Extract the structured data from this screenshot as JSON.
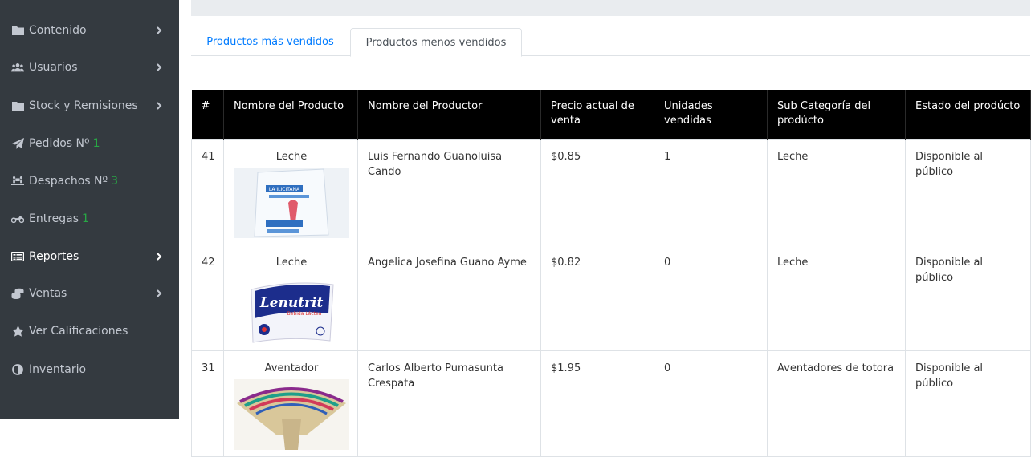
{
  "sidebar": {
    "items": [
      {
        "label": "Contenido",
        "icon": "folder-icon",
        "count": "",
        "has_chevron": true
      },
      {
        "label": "Usuarios",
        "icon": "users-icon",
        "count": "",
        "has_chevron": true
      },
      {
        "label": "Stock y Remisiones",
        "icon": "folder-icon",
        "count": "",
        "has_chevron": true
      },
      {
        "label": "Pedidos Nº",
        "icon": "paper-plane-icon",
        "count": "1",
        "has_chevron": false
      },
      {
        "label": "Despachos Nº",
        "icon": "people-carry-icon",
        "count": "3",
        "has_chevron": false
      },
      {
        "label": "Entregas",
        "icon": "motorcycle-icon",
        "count": "1",
        "has_chevron": false
      },
      {
        "label": "Reportes",
        "icon": "report-icon",
        "count": "",
        "has_chevron": true
      },
      {
        "label": "Ventas",
        "icon": "coins-icon",
        "count": "",
        "has_chevron": true
      },
      {
        "label": "Ver Calificaciones",
        "icon": "star-icon",
        "count": "",
        "has_chevron": false
      },
      {
        "label": "Inventario",
        "icon": "adjust-icon",
        "count": "",
        "has_chevron": false
      }
    ],
    "active_item": "Reportes",
    "colors": {
      "background": "#343a40",
      "text": "#c2c7d0",
      "count": "#28a745"
    }
  },
  "tabs": [
    {
      "label": "Productos más vendidos",
      "active": false
    },
    {
      "label": "Productos menos vendidos",
      "active": true
    }
  ],
  "table": {
    "headers": [
      "#",
      "Nombre del Producto",
      "Nombre del Productor",
      "Precio actual de venta",
      "Unidades vendidas",
      "Sub Categoría del prodúcto",
      "Estado del prodúcto"
    ],
    "rows": [
      {
        "id": "41",
        "product": "Leche",
        "image": "milk-bag-la-ilicitana",
        "producer": "Luis Fernando Guanoluisa Cando",
        "price": "$0.85",
        "units": "1",
        "subcategory": "Leche",
        "status": "Disponible al público"
      },
      {
        "id": "42",
        "product": "Leche",
        "image": "milk-bag-lenutrit",
        "producer": "Angelica Josefina Guano Ayme",
        "price": "$0.82",
        "units": "0",
        "subcategory": "Leche",
        "status": "Disponible al público"
      },
      {
        "id": "31",
        "product": "Aventador",
        "image": "woven-fan",
        "producer": "Carlos Alberto Pumasunta Crespata",
        "price": "$1.95",
        "units": "0",
        "subcategory": "Aventadores de totora",
        "status": "Disponible al público"
      }
    ],
    "image_texts": {
      "ilicitana": "LA ILICITANA",
      "lenutrit": "Lenutrit",
      "lenutrit_sub": "Bebida Láctea"
    },
    "colors": {
      "header_bg": "#000000",
      "header_text": "#ffffff",
      "link": "#007bff"
    }
  }
}
